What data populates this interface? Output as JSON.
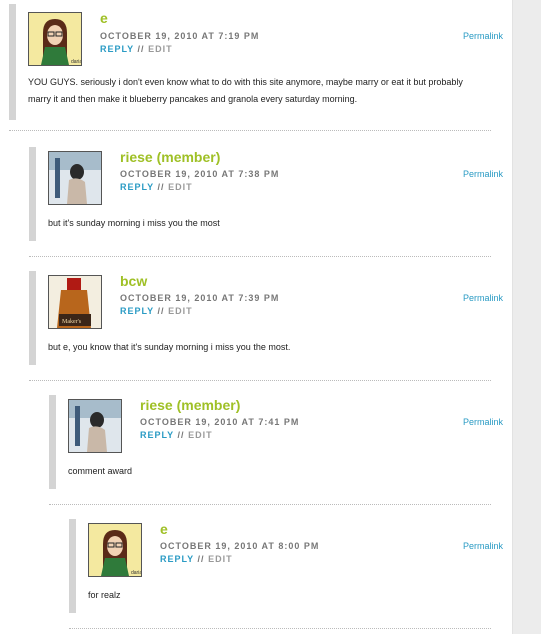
{
  "comments": [
    {
      "author": "e",
      "date": "OCTOBER 19, 2010 AT 7:19 PM",
      "reply": "REPLY",
      "separator": "//",
      "edit": "EDIT",
      "permalink": "Permalink",
      "body": "YOU GUYS. seriously i don't even know what to do with this site anymore, maybe marry or eat it but probably marry it and then make it blueberry pancakes and granola every saturday morning.",
      "avatar_icon": "cartoon-girl-avatar",
      "avatar_caption": "daria"
    },
    {
      "author": "riese (member)",
      "date": "OCTOBER 19, 2010 AT 7:38 PM",
      "reply": "REPLY",
      "separator": "//",
      "edit": "EDIT",
      "permalink": "Permalink",
      "body": "but it's sunday morning i miss you the most",
      "avatar_icon": "photo-avatar"
    },
    {
      "author": "bcw",
      "date": "OCTOBER 19, 2010 AT 7:39 PM",
      "reply": "REPLY",
      "separator": "//",
      "edit": "EDIT",
      "permalink": "Permalink",
      "body": "but e, you know that it's sunday morning i miss you the most.",
      "avatar_icon": "bottle-avatar",
      "avatar_caption": "Maker's"
    },
    {
      "author": "riese (member)",
      "date": "OCTOBER 19, 2010 AT 7:41 PM",
      "reply": "REPLY",
      "separator": "//",
      "edit": "EDIT",
      "permalink": "Permalink",
      "body": "comment award",
      "avatar_icon": "photo-avatar"
    },
    {
      "author": "e",
      "date": "OCTOBER 19, 2010 AT 8:00 PM",
      "reply": "REPLY",
      "separator": "//",
      "edit": "EDIT",
      "permalink": "Permalink",
      "body": "for realz",
      "avatar_icon": "cartoon-girl-avatar",
      "avatar_caption": "daria"
    }
  ],
  "colors": {
    "author": "#9fc026",
    "link": "#2a9bc4",
    "thread_bar": "#d4d4d4"
  }
}
